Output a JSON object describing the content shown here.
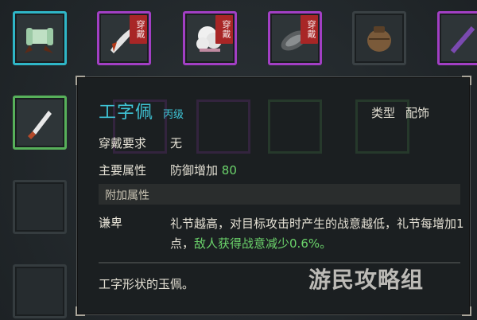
{
  "inventory": {
    "wear_tag": "穿戴"
  },
  "tooltip": {
    "name": "工字佩",
    "grade": "丙级",
    "type_label": "类型",
    "type_value": "配饰",
    "wear_req_label": "穿戴要求",
    "wear_req_value": "无",
    "main_attr_label": "主要属性",
    "main_attr_value": "防御增加",
    "main_attr_number": "80",
    "extra_attr_header": "附加属性",
    "trait_name": "谦卑",
    "trait_text_1": "礼节越高，对目标攻击时产生的战意越低，礼节每增加1点，",
    "trait_text_highlight": "敌人获得战意减少0.6%。",
    "description": "工字形状的玉佩。"
  },
  "watermark": "游民攻略组",
  "colors": {
    "cyan_frame": "#2fb6c7",
    "purple_frame": "#a23fc4",
    "green_frame": "#57b05a",
    "name_color": "#3fc4d6",
    "highlight_green": "#6bd36b",
    "wear_tag_red": "#a82626"
  }
}
